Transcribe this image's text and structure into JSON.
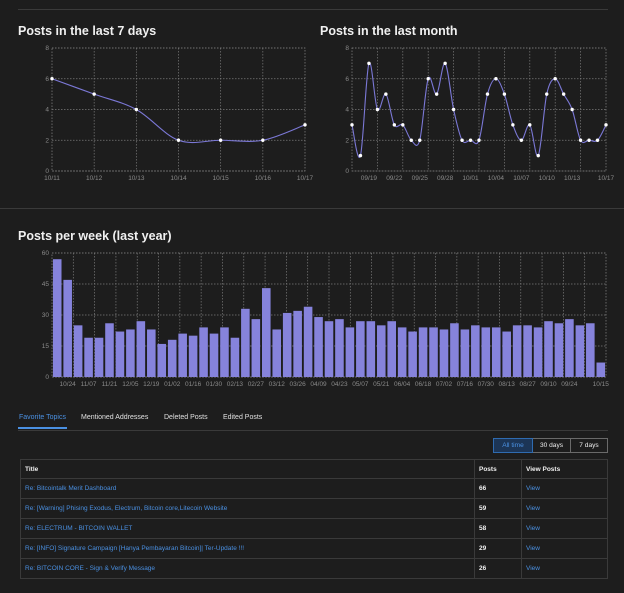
{
  "charts": {
    "last7": {
      "title": "Posts in the last 7 days",
      "chart_data": {
        "type": "line",
        "x": [
          "10/11",
          "10/12",
          "10/13",
          "10/14",
          "10/15",
          "10/16",
          "10/17"
        ],
        "values": [
          6,
          5,
          4,
          2,
          2,
          2,
          3
        ],
        "ylim": [
          0,
          8
        ],
        "yticks": [
          "0",
          "2",
          "4",
          "6",
          "8"
        ],
        "grid": true,
        "color": "#7b78d6"
      }
    },
    "lastMonth": {
      "title": "Posts in the last month",
      "chart_data": {
        "type": "line",
        "xticks": [
          "09/19",
          "09/22",
          "09/25",
          "09/28",
          "10/01",
          "10/04",
          "10/07",
          "10/10",
          "10/13",
          "10/17"
        ],
        "values": [
          3,
          1,
          7,
          4,
          5,
          3,
          3,
          2,
          2,
          6,
          5,
          7,
          4,
          2,
          2,
          2,
          5,
          6,
          5,
          3,
          2,
          3,
          1,
          5,
          6,
          5,
          4,
          2,
          2,
          2,
          3
        ],
        "ylim": [
          0,
          8
        ],
        "yticks": [
          "0",
          "2",
          "4",
          "6",
          "8"
        ],
        "grid": true,
        "color": "#7b78d6"
      }
    },
    "perWeek": {
      "title": "Posts per week (last year)",
      "chart_data": {
        "type": "bar",
        "xticks": [
          "10/24",
          "11/07",
          "11/21",
          "12/05",
          "12/19",
          "01/02",
          "01/16",
          "01/30",
          "02/13",
          "02/27",
          "03/12",
          "03/26",
          "04/09",
          "04/23",
          "05/07",
          "05/21",
          "06/04",
          "06/18",
          "07/02",
          "07/16",
          "07/30",
          "08/13",
          "08/27",
          "09/10",
          "09/24",
          "10/15"
        ],
        "values": [
          57,
          47,
          25,
          19,
          19,
          26,
          22,
          23,
          27,
          23,
          16,
          18,
          21,
          20,
          24,
          21,
          24,
          19,
          33,
          28,
          43,
          23,
          31,
          32,
          34,
          29,
          27,
          28,
          24,
          27,
          27,
          25,
          27,
          24,
          22,
          24,
          24,
          23,
          26,
          23,
          25,
          24,
          24,
          22,
          25,
          25,
          24,
          27,
          26,
          28,
          25,
          26,
          7
        ],
        "ylim": [
          0,
          60
        ],
        "yticks": [
          "0",
          "15",
          "30",
          "45",
          "60"
        ],
        "grid": true,
        "color": "#8683dc"
      }
    }
  },
  "tabs": [
    "Favorite Topics",
    "Mentioned Addresses",
    "Deleted Posts",
    "Edited Posts"
  ],
  "range_buttons": [
    "All time",
    "30 days",
    "7 days"
  ],
  "table": {
    "headers": [
      "Title",
      "Posts",
      "View Posts"
    ],
    "rows": [
      {
        "title": "Re: Bitcointalk Merit Dashboard",
        "posts": "66",
        "view": "View"
      },
      {
        "title": "Re: [Warning] Phising Exodus, Electrum, Bitcoin core,Litecoin Website",
        "posts": "59",
        "view": "View"
      },
      {
        "title": "Re: ELECTRUM - BITCOIN WALLET",
        "posts": "58",
        "view": "View"
      },
      {
        "title": "Re: [INFO] Signature Campaign [Hanya Pembayaran Bitcoin]| Ter-Update !!!",
        "posts": "29",
        "view": "View"
      },
      {
        "title": "Re: BITCOIN CORE - Sign & Verify Message",
        "posts": "26",
        "view": "View"
      }
    ]
  }
}
